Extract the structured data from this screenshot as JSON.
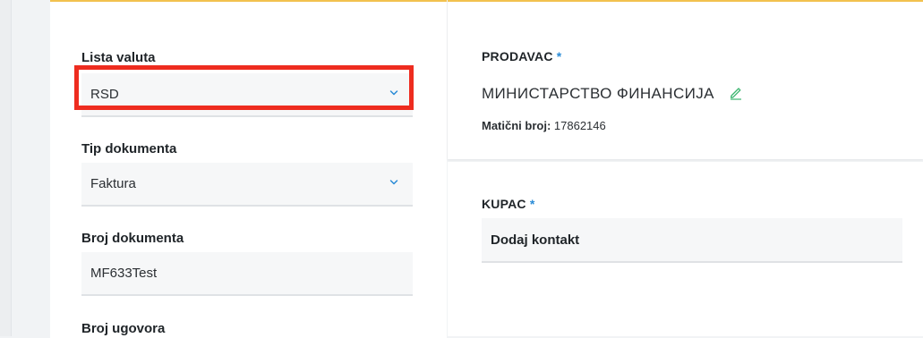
{
  "form": {
    "currency_list": {
      "label": "Lista valuta",
      "value": "RSD"
    },
    "document_type": {
      "label": "Tip dokumenta",
      "value": "Faktura"
    },
    "document_number": {
      "label": "Broj dokumenta",
      "value": "MF633Test"
    },
    "contract_number": {
      "label": "Broj ugovora"
    }
  },
  "seller": {
    "title": "PRODAVAC",
    "required_mark": "*",
    "name": "МИНИСТАРСТВО ФИНАНСИЈА",
    "registration_label": "Matični broj:",
    "registration_value": "17862146"
  },
  "buyer": {
    "title": "KUPAC",
    "required_mark": "*",
    "add_contact_label": "Dodaj kontakt"
  },
  "colors": {
    "accent": "#2a8bd6",
    "highlight": "#ee2c1f",
    "top_border": "#f2c14e",
    "edit_icon": "#3bb56f"
  },
  "icons": {
    "dropdown": "chevron-down-icon",
    "edit": "pencil-icon"
  }
}
